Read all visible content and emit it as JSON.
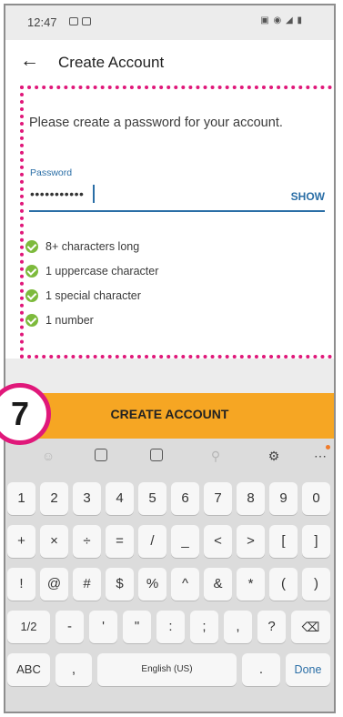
{
  "status": {
    "time": "12:47"
  },
  "header": {
    "title": "Create Account"
  },
  "form": {
    "instruction": "Please create a password for your account.",
    "password_label": "Password",
    "password_value": "•••••••••••",
    "show_label": "SHOW"
  },
  "requirements": [
    {
      "label": "8+ characters long",
      "met": true
    },
    {
      "label": "1 uppercase character",
      "met": true
    },
    {
      "label": "1 special character",
      "met": true
    },
    {
      "label": "1 number",
      "met": true
    }
  ],
  "primary_button": {
    "label": "CREATE ACCOUNT",
    "color": "#f6a623"
  },
  "callout": {
    "step": "7",
    "color": "#e0187a"
  },
  "keyboard": {
    "row1": [
      "1",
      "2",
      "3",
      "4",
      "5",
      "6",
      "7",
      "8",
      "9",
      "0"
    ],
    "row2": [
      "+",
      "×",
      "÷",
      "=",
      "/",
      "_",
      "<",
      ">",
      "[",
      "]"
    ],
    "row3": [
      "!",
      "@",
      "#",
      "$",
      "%",
      "^",
      "&",
      "*",
      "(",
      ")"
    ],
    "row4": [
      "1/2",
      "-",
      "'",
      "\"",
      ":",
      ";",
      ",",
      "?"
    ],
    "bottom": {
      "abc": "ABC",
      "comma": ",",
      "space": "English (US)",
      "period": ".",
      "done": "Done"
    }
  }
}
